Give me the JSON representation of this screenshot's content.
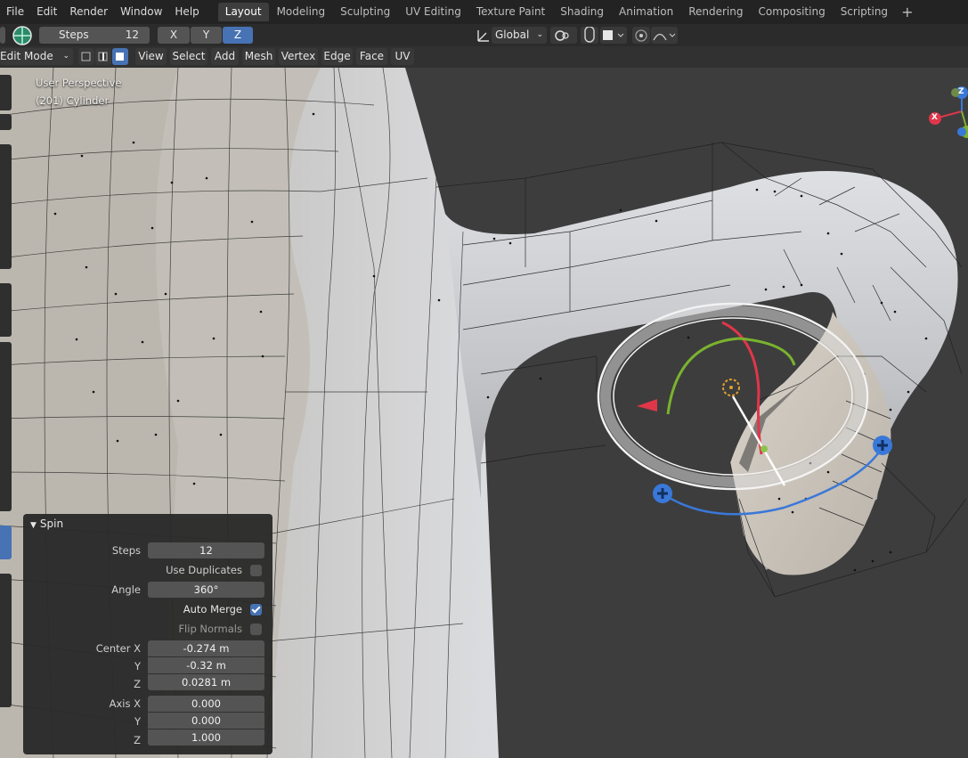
{
  "menu": [
    "File",
    "Edit",
    "Render",
    "Window",
    "Help"
  ],
  "workspaces": [
    "Layout",
    "Modeling",
    "Sculpting",
    "UV Editing",
    "Texture Paint",
    "Shading",
    "Animation",
    "Rendering",
    "Compositing",
    "Scripting"
  ],
  "add_workspace": "+",
  "tool_settings": {
    "steps_label": "Steps",
    "steps_value": "12",
    "axis_x": "X",
    "axis_y": "Y",
    "axis_z": "Z",
    "transform_orientation": "Global"
  },
  "header": {
    "mode": "Edit Mode",
    "menus": [
      "View",
      "Select",
      "Add",
      "Mesh",
      "Vertex",
      "Edge",
      "Face",
      "UV"
    ]
  },
  "viewport": {
    "view_name": "User Perspective",
    "object_info": "(201) Cylinder",
    "gizmo_axes": [
      "X",
      "Y",
      "Z"
    ]
  },
  "spin_panel": {
    "title": "Spin",
    "steps_label": "Steps",
    "steps": "12",
    "use_duplicates_label": "Use Duplicates",
    "use_duplicates": false,
    "angle_label": "Angle",
    "angle": "360°",
    "auto_merge_label": "Auto Merge",
    "auto_merge": true,
    "flip_normals_label": "Flip Normals",
    "flip_normals": false,
    "center_x_label": "Center X",
    "center_x": "-0.274 m",
    "center_y_label": "Y",
    "center_y": "-0.32 m",
    "center_z_label": "Z",
    "center_z": "0.0281 m",
    "axis_x_label": "Axis X",
    "axis_x": "0.000",
    "axis_y_label": "Y",
    "axis_y": "0.000",
    "axis_z_label": "Z",
    "axis_z": "1.000"
  },
  "colors": {
    "accent": "#4772b3",
    "background": "#3d3d3d",
    "mesh": "#c9c9cc",
    "gizmo_red": "#e0364a",
    "gizmo_green": "#7ab32e",
    "gizmo_blue": "#3a78d8"
  }
}
